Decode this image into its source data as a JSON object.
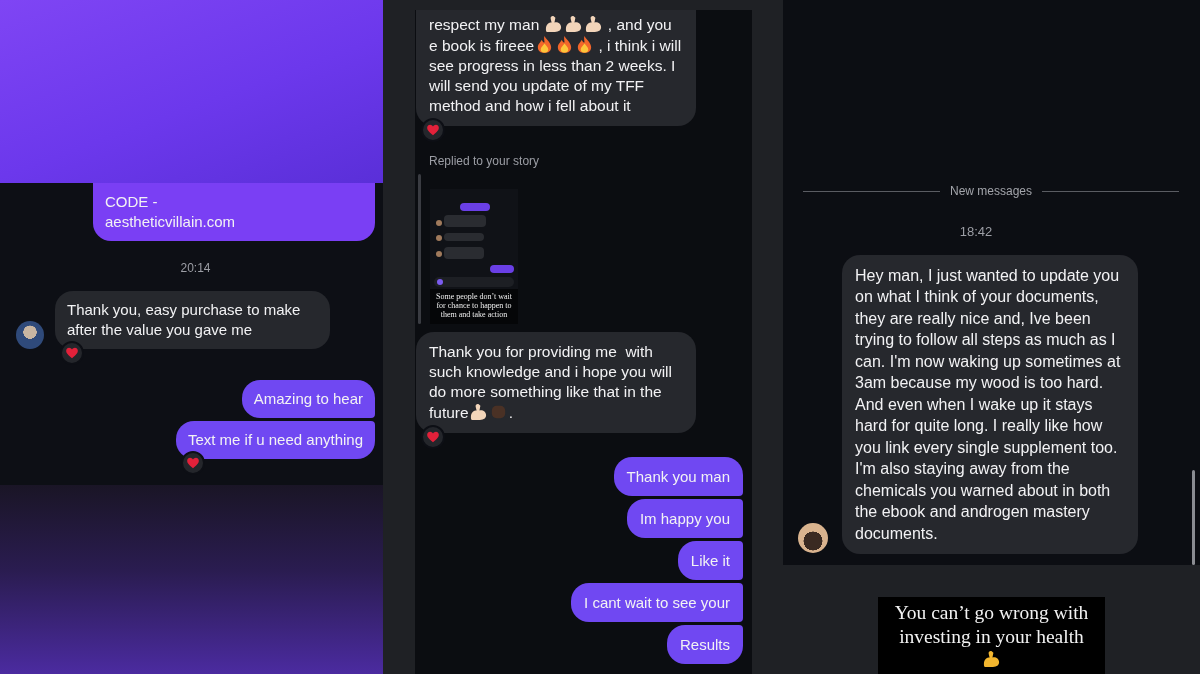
{
  "screens": [
    {
      "kind": "banner",
      "messages": [
        {
          "kind": "outgoing",
          "text": "CODE -\naestheticvillain.com",
          "reacted": false
        },
        {
          "kind": "time",
          "text": "20:14"
        },
        {
          "kind": "incoming",
          "avatar": true,
          "text": "Thank you, easy purchase to make after the value you gave me",
          "reacted": true
        },
        {
          "kind": "outgoing",
          "text": "Amazing to hear",
          "reacted": false
        },
        {
          "kind": "outgoing",
          "text": "Text me if u need anything",
          "reacted": true
        }
      ]
    },
    {
      "kind": "framed",
      "messages": [
        {
          "kind": "incoming",
          "avatar": false,
          "parts": [
            {
              "kind": "text",
              "text": "respect my man "
            },
            {
              "kind": "flex",
              "color": "#f2d5ba"
            },
            {
              "kind": "flex",
              "color": "#f2d5ba"
            },
            {
              "kind": "flex",
              "color": "#f2d5ba"
            },
            {
              "kind": "text",
              "text": " , and you e book is fireee"
            },
            {
              "kind": "fire"
            },
            {
              "kind": "fire"
            },
            {
              "kind": "fire"
            },
            {
              "kind": "text",
              "text": " , i think i will see progress in less than 2 weeks. I will send you update of my TFF method and how i fell about it"
            }
          ],
          "reacted": true
        },
        {
          "kind": "story_reply",
          "label": "Replied to your story",
          "caption": "Some people don’t wait for chance to happen to them and take action"
        },
        {
          "kind": "incoming",
          "avatar": false,
          "parts": [
            {
              "kind": "text",
              "text": "Thank you for providing me  with such knowledge and i hope you will do more something like that in the future"
            },
            {
              "kind": "flex",
              "color": "#f2d5ba"
            },
            {
              "kind": "fist",
              "color": "#4a3125"
            },
            {
              "kind": "text",
              "text": "."
            }
          ],
          "reacted": true
        },
        {
          "kind": "outgoing",
          "text": "Thank you man",
          "reacted": false
        },
        {
          "kind": "outgoing",
          "text": "Im happy you",
          "reacted": false
        },
        {
          "kind": "outgoing",
          "text": "Like it",
          "reacted": false
        },
        {
          "kind": "outgoing",
          "text": "I cant wait to see your",
          "reacted": false
        },
        {
          "kind": "outgoing",
          "text": "Results",
          "reacted": false
        }
      ]
    },
    {
      "kind": "plain",
      "messages": [
        {
          "kind": "divider",
          "text": "New messages"
        },
        {
          "kind": "time",
          "text": "18:42"
        },
        {
          "kind": "incoming",
          "avatar": true,
          "text": "Hey man, I just wanted to update you on what I think of your documents, they are really nice and, Ive been trying to follow all steps as much as I can. I'm now waking up sometimes at 3am because my wood is too hard. And even when I wake up it stays hard for quite long. I really like how you link every single supplement too. I'm also staying away from the chemicals you warned about in both the ebook and androgen mastery documents.",
          "reacted": false
        }
      ],
      "story": {
        "parts": [
          {
            "kind": "text",
            "text": "You can’t go wrong with investing in your health"
          },
          {
            "kind": "flex",
            "color": "#f3b62f"
          }
        ]
      }
    }
  ]
}
